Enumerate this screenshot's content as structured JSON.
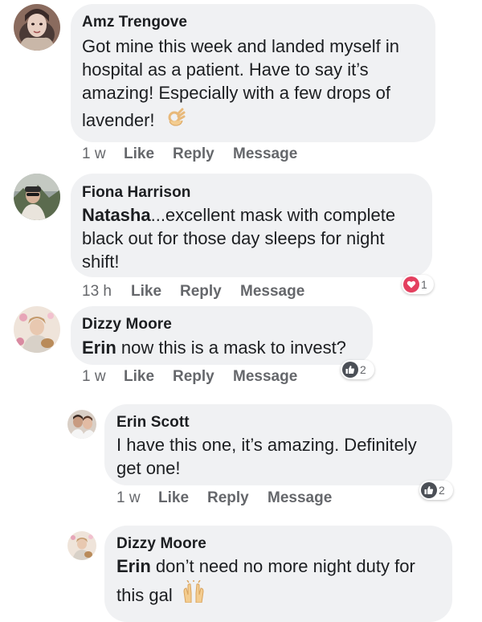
{
  "comments": [
    {
      "author": "Amz Trengove",
      "lines": [
        "Got mine this week and landed myself in",
        "hospital as a patient. Have to say it’s",
        "amazing! Especially with a few drops of",
        "lavender!"
      ],
      "emoji": "ok-hand-icon",
      "time": "1 w",
      "like": "Like",
      "reply": "Reply",
      "message": "Message"
    },
    {
      "author": "Fiona Harrison",
      "mention": "Natasha",
      "line1_rest": "...excellent mask with complete",
      "lines": [
        "black out for those day sleeps for night",
        "shift!"
      ],
      "time": "13 h",
      "like": "Like",
      "reply": "Reply",
      "message": "Message",
      "reaction_icon": "heart-reaction-icon",
      "reaction_count": "1"
    },
    {
      "author": "Dizzy Moore",
      "mention": "Erin",
      "line1_rest": " now this is a mask to invest?",
      "time": "1 w",
      "like": "Like",
      "reply": "Reply",
      "message": "Message",
      "reaction_icon": "thumbs-up-reaction-icon",
      "reaction_count": "2"
    },
    {
      "author": "Erin Scott",
      "lines": [
        "I have this one, it’s amazing. Definitely",
        "get one!"
      ],
      "time": "1 w",
      "like": "Like",
      "reply": "Reply",
      "message": "Message",
      "reaction_icon": "thumbs-up-reaction-icon",
      "reaction_count": "2"
    },
    {
      "author": "Dizzy Moore",
      "mention": "Erin",
      "line1_rest": " don’t need no more night duty for",
      "lines": [
        "this gal"
      ],
      "emoji": "raised-hands-icon"
    }
  ],
  "colors": {
    "bubble": "#f0f1f3",
    "text": "#1c1e21",
    "meta": "#65676b",
    "heart": "#e4405f",
    "like_blue_dark": "#4b4f56"
  }
}
